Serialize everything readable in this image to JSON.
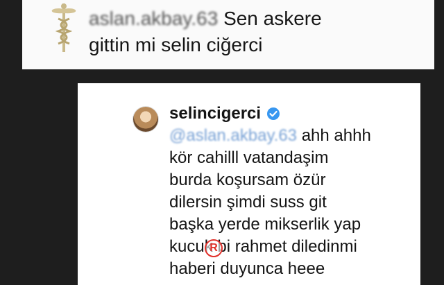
{
  "top_comment": {
    "username": "aslan.akbay.63",
    "text_line1": "Sen askere",
    "text_line2": "gittin mi selin ciğerci"
  },
  "reply_comment": {
    "username": "selincigerci",
    "mention": "@aslan.akbay.63",
    "lines": [
      "ahh ahhh",
      "kör cahilll vatandaşim",
      "burda koşursam özür",
      "dilersin şimdi suss git",
      "başka yerde mikserlik yap",
      "kucuk bi rahmet diledinmi",
      "haberi duyunca heee"
    ]
  },
  "watermark": "R",
  "colors": {
    "background": "#1e1e1e",
    "verified_badge": "#3897f0",
    "watermark": "#e0302a"
  },
  "icons": {
    "top_avatar": "caduceus-icon",
    "verified": "verified-badge-icon"
  }
}
